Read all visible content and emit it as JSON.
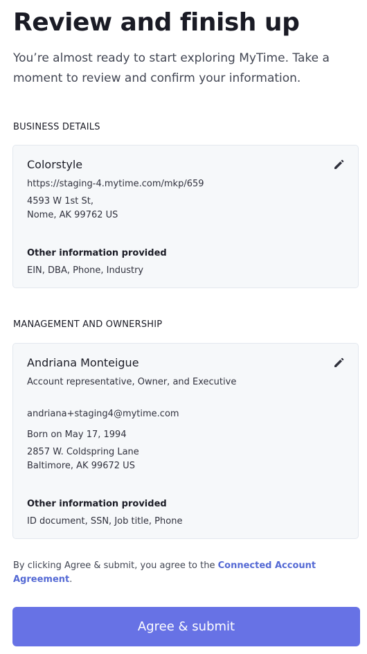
{
  "header": {
    "title": "Review and finish up",
    "intro": "You’re almost ready to start exploring MyTime. Take a moment to review and confirm your information."
  },
  "business": {
    "heading": "BUSINESS DETAILS",
    "name": "Colorstyle",
    "url": "https://staging-4.mytime.com/mkp/659",
    "address_line1": "4593 W 1st St,",
    "address_line2": "Nome, AK 99762 US",
    "other_label": "Other information provided",
    "other_value": "EIN, DBA, Phone, Industry",
    "edit_icon": "pencil-icon"
  },
  "management": {
    "heading": "MANAGEMENT AND OWNERSHIP",
    "name": "Andriana Monteigue",
    "roles": "Account representative, Owner, and Executive",
    "email": "andriana+staging4@mytime.com",
    "born": "Born on May 17, 1994",
    "address_line1": "2857 W. Coldspring Lane",
    "address_line2": "Baltimore, AK 99672 US",
    "other_label": "Other information provided",
    "other_value": "ID document, SSN, Job title, Phone",
    "edit_icon": "pencil-icon"
  },
  "agreement": {
    "prefix": "By clicking Agree & submit, you agree to the ",
    "link": "Connected Account Agreement",
    "suffix": "."
  },
  "submit": {
    "label": "Agree & submit"
  },
  "colors": {
    "accent": "#6772e5",
    "link": "#5469d4",
    "card_bg": "#f6f8fa"
  }
}
